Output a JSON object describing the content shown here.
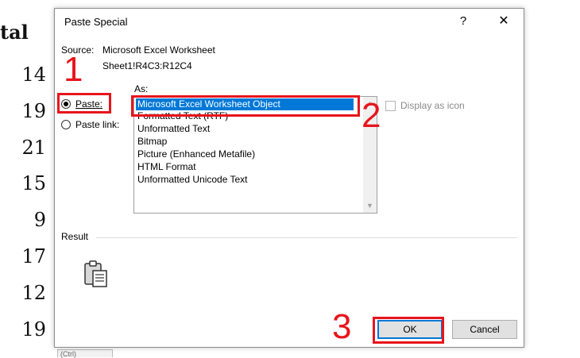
{
  "background": {
    "column_header": "tal",
    "values": [
      "14",
      "19",
      "21",
      "15",
      "9",
      "17",
      "12",
      "19"
    ],
    "clipboard_hint": "(Ctrl)"
  },
  "dialog": {
    "title": "Paste Special",
    "help": "?",
    "close": "✕",
    "source_label": "Source:",
    "source_value": "Microsoft Excel Worksheet",
    "source_range": "Sheet1!R4C3:R12C4",
    "paste_option": "Paste:",
    "paste_link_option": "Paste link:",
    "selected_option": "Paste:",
    "as_label": "As:",
    "as_items": [
      "Microsoft Excel Worksheet Object",
      "Formatted Text (RTF)",
      "Unformatted Text",
      "Bitmap",
      "Picture (Enhanced Metafile)",
      "HTML Format",
      "Unformatted Unicode Text"
    ],
    "selected_item": "Microsoft Excel Worksheet Object",
    "display_as_icon": "Display as icon",
    "display_as_icon_checked": false,
    "result_label": "Result",
    "ok": "OK",
    "cancel": "Cancel"
  },
  "annotations": [
    "1",
    "2",
    "3"
  ],
  "colors": {
    "annotation": "#e8141c",
    "selection": "#0078d7"
  }
}
